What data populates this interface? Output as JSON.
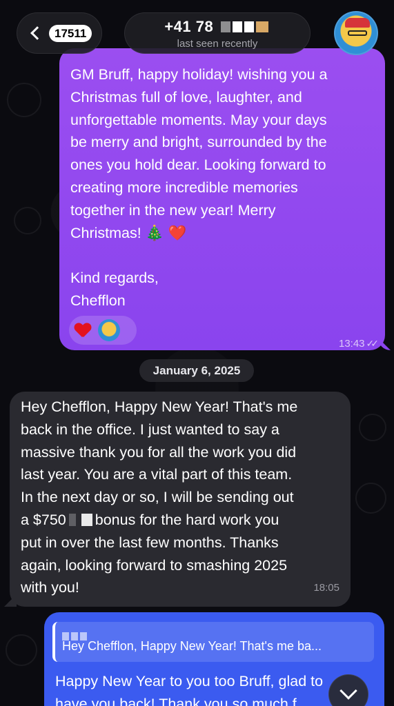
{
  "header": {
    "unread_count": "17511",
    "contact_name": "+41 78",
    "status": "last seen recently"
  },
  "messages": {
    "outgoing": {
      "text": "GM Bruff, happy holiday! wishing you a\nChristmas full of love, laughter, and\nunforgettable moments. May your days\nbe merry and bright, surrounded by the\nones you hold dear. Looking forward to\ncreating more incredible memories\ntogether in the new year! Merry\nChristmas! 🎄 ❤️\n\nKind regards,\nChefflon",
      "time": "13:43",
      "reactions": [
        "red-heart",
        "user-avatar"
      ]
    },
    "date_separator": "January 6, 2025",
    "incoming": {
      "text_part1": "Hey Chefflon, Happy New Year! That's me\nback in the office. I just wanted to say a\nmassive thank you for all the work you did\nlast year. You are a vital part of this team.\nIn the next day or so, I will be sending out\na $750",
      "text_part2": "bonus for the hard work you\nput in over the last few months. Thanks\nagain, looking forward to smashing 2025\nwith you!",
      "time": "18:05"
    },
    "reply": {
      "quote_text": "Hey Chefflon, Happy New Year! That's me ba...",
      "text": "Happy New Year to you too Bruff, glad to\nhave you back! Thank you so much f"
    }
  },
  "colors": {
    "outgoing_bubble": "#8a44ee",
    "incoming_bubble": "#2a2a30",
    "reply_bubble": "#3b5bf0"
  }
}
